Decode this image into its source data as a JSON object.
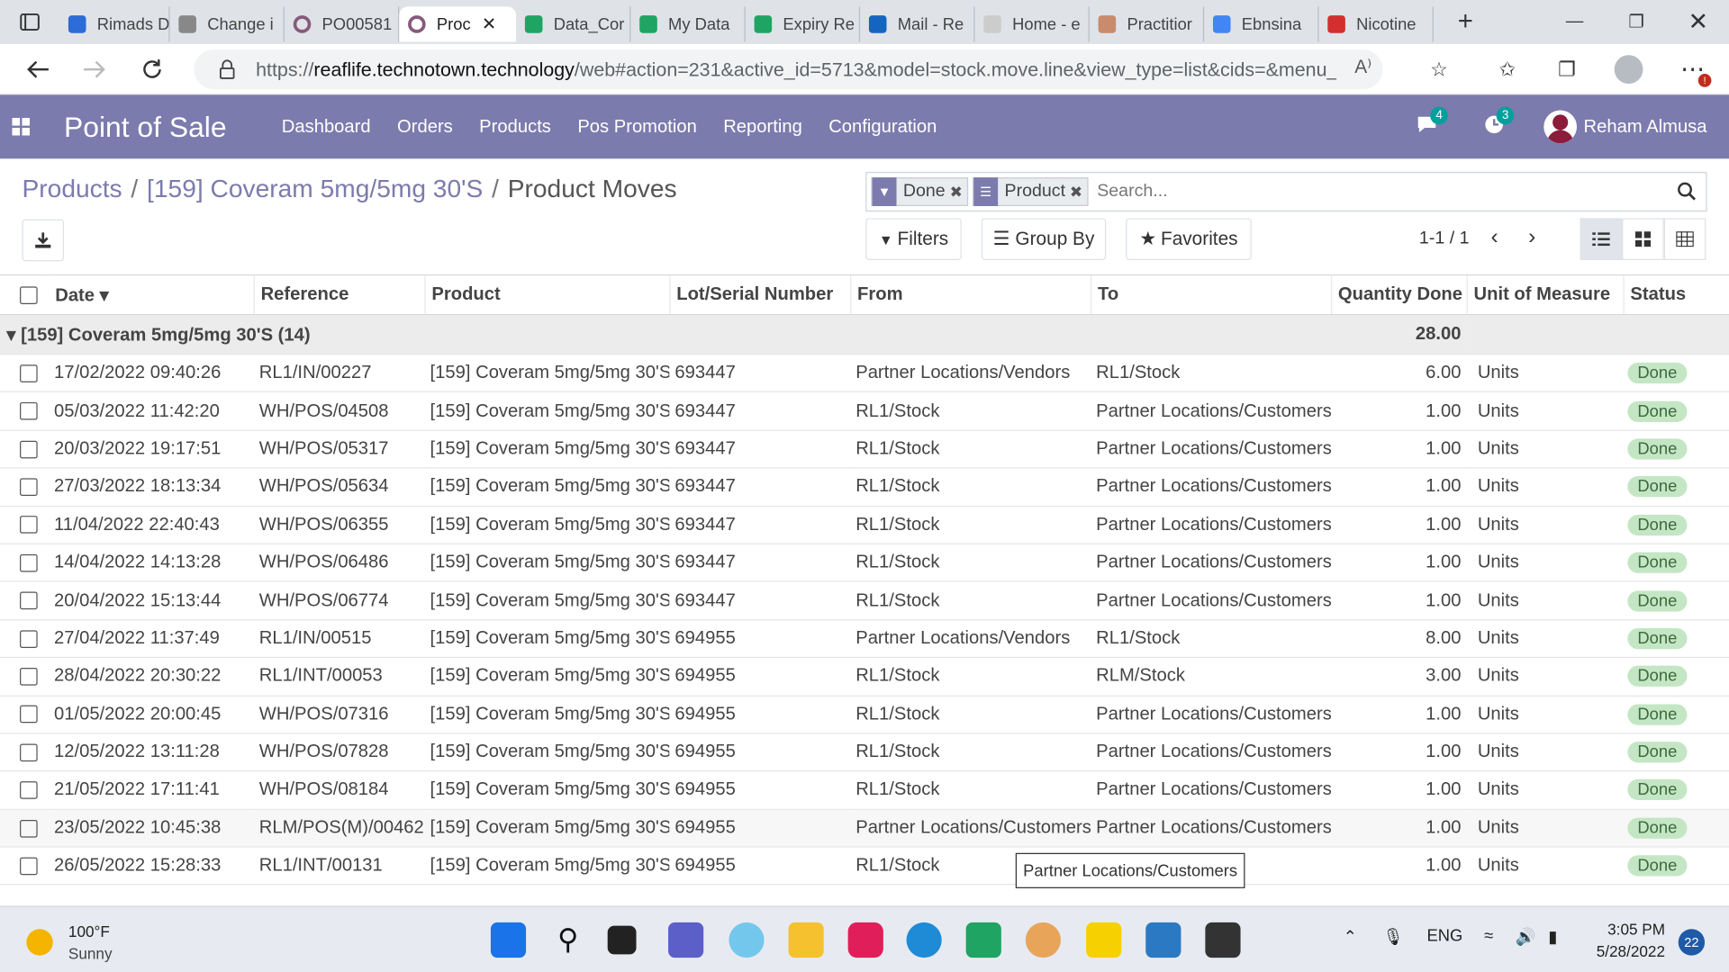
{
  "browser": {
    "tabs": [
      {
        "label": "Rimads D",
        "color": "#2d6bd6"
      },
      {
        "label": "Change i",
        "color": "#888888"
      },
      {
        "label": "PO00581",
        "color": "#875a7b"
      },
      {
        "label": "Proc",
        "color": "#875a7b",
        "active": true
      },
      {
        "label": "Data_Cor",
        "color": "#1fa463"
      },
      {
        "label": "My Data",
        "color": "#1fa463"
      },
      {
        "label": "Expiry Re",
        "color": "#1fa463"
      },
      {
        "label": "Mail - Re",
        "color": "#1565c0"
      },
      {
        "label": "Home - e",
        "color": "#cccccc"
      },
      {
        "label": "Practitior",
        "color": "#c98b6b"
      },
      {
        "label": "Ebnsina",
        "color": "#4285f4"
      },
      {
        "label": "Nicotine",
        "color": "#d32f2f"
      }
    ],
    "url_prefix": "https://",
    "url_host": "reaflife.technotown.technology",
    "url_rest": "/web#action=231&active_id=5713&model=stock.move.line&view_type=list&cids=&menu_i..."
  },
  "odoo": {
    "app_name": "Point of Sale",
    "menu": [
      "Dashboard",
      "Orders",
      "Products",
      "Pos Promotion",
      "Reporting",
      "Configuration"
    ],
    "messages_count": "4",
    "activities_count": "3",
    "user_name": "Reham Almusa"
  },
  "breadcrumb": {
    "root": "Products",
    "product": "[159] Coveram 5mg/5mg 30'S",
    "current": "Product Moves",
    "separator": "/"
  },
  "search": {
    "facets": [
      {
        "label": "Done",
        "icon": "filter-icon"
      },
      {
        "label": "Product",
        "icon": "group-by-icon"
      }
    ],
    "placeholder": "Search..."
  },
  "controls": {
    "filters": "Filters",
    "group_by": "Group By",
    "favorites": "Favorites",
    "pager": "1-1 / 1"
  },
  "table": {
    "columns": [
      "Date",
      "Reference",
      "Product",
      "Lot/Serial Number",
      "From",
      "To",
      "Quantity Done",
      "Unit of Measure",
      "Status"
    ],
    "group": {
      "label": "[159] Coveram 5mg/5mg 30'S (14)",
      "total": "28.00"
    },
    "rows": [
      [
        "17/02/2022 09:40:26",
        "RL1/IN/00227",
        "[159] Coveram 5mg/5mg 30'S",
        "693447",
        "Partner Locations/Vendors",
        "RL1/Stock",
        "6.00",
        "Units",
        "Done"
      ],
      [
        "05/03/2022 11:42:20",
        "WH/POS/04508",
        "[159] Coveram 5mg/5mg 30'S",
        "693447",
        "RL1/Stock",
        "Partner Locations/Customers",
        "1.00",
        "Units",
        "Done"
      ],
      [
        "20/03/2022 19:17:51",
        "WH/POS/05317",
        "[159] Coveram 5mg/5mg 30'S",
        "693447",
        "RL1/Stock",
        "Partner Locations/Customers",
        "1.00",
        "Units",
        "Done"
      ],
      [
        "27/03/2022 18:13:34",
        "WH/POS/05634",
        "[159] Coveram 5mg/5mg 30'S",
        "693447",
        "RL1/Stock",
        "Partner Locations/Customers",
        "1.00",
        "Units",
        "Done"
      ],
      [
        "11/04/2022 22:40:43",
        "WH/POS/06355",
        "[159] Coveram 5mg/5mg 30'S",
        "693447",
        "RL1/Stock",
        "Partner Locations/Customers",
        "1.00",
        "Units",
        "Done"
      ],
      [
        "14/04/2022 14:13:28",
        "WH/POS/06486",
        "[159] Coveram 5mg/5mg 30'S",
        "693447",
        "RL1/Stock",
        "Partner Locations/Customers",
        "1.00",
        "Units",
        "Done"
      ],
      [
        "20/04/2022 15:13:44",
        "WH/POS/06774",
        "[159] Coveram 5mg/5mg 30'S",
        "693447",
        "RL1/Stock",
        "Partner Locations/Customers",
        "1.00",
        "Units",
        "Done"
      ],
      [
        "27/04/2022 11:37:49",
        "RL1/IN/00515",
        "[159] Coveram 5mg/5mg 30'S",
        "694955",
        "Partner Locations/Vendors",
        "RL1/Stock",
        "8.00",
        "Units",
        "Done"
      ],
      [
        "28/04/2022 20:30:22",
        "RL1/INT/00053",
        "[159] Coveram 5mg/5mg 30'S",
        "694955",
        "RL1/Stock",
        "RLM/Stock",
        "3.00",
        "Units",
        "Done"
      ],
      [
        "01/05/2022 20:00:45",
        "WH/POS/07316",
        "[159] Coveram 5mg/5mg 30'S",
        "694955",
        "RL1/Stock",
        "Partner Locations/Customers",
        "1.00",
        "Units",
        "Done"
      ],
      [
        "12/05/2022 13:11:28",
        "WH/POS/07828",
        "[159] Coveram 5mg/5mg 30'S",
        "694955",
        "RL1/Stock",
        "Partner Locations/Customers",
        "1.00",
        "Units",
        "Done"
      ],
      [
        "21/05/2022 17:11:41",
        "WH/POS/08184",
        "[159] Coveram 5mg/5mg 30'S",
        "694955",
        "RL1/Stock",
        "Partner Locations/Customers",
        "1.00",
        "Units",
        "Done"
      ],
      [
        "23/05/2022 10:45:38",
        "RLM/POS(M)/00462",
        "[159] Coveram 5mg/5mg 30'S",
        "694955",
        "Partner Locations/Customers",
        "Partner Locations/Customers",
        "1.00",
        "Units",
        "Done"
      ],
      [
        "26/05/2022 15:28:33",
        "RL1/INT/00131",
        "[159] Coveram 5mg/5mg 30'S",
        "694955",
        "RL1/Stock",
        "",
        "1.00",
        "Units",
        "Done"
      ]
    ],
    "tooltip": "Partner Locations/Customers"
  },
  "taskbar": {
    "temperature": "100°F",
    "condition": "Sunny",
    "language": "ENG",
    "time": "3:05 PM",
    "date": "5/28/2022",
    "notifications": "22"
  },
  "colors": {
    "brand": "#7c7bad",
    "status_done": "#c4e6c4"
  }
}
